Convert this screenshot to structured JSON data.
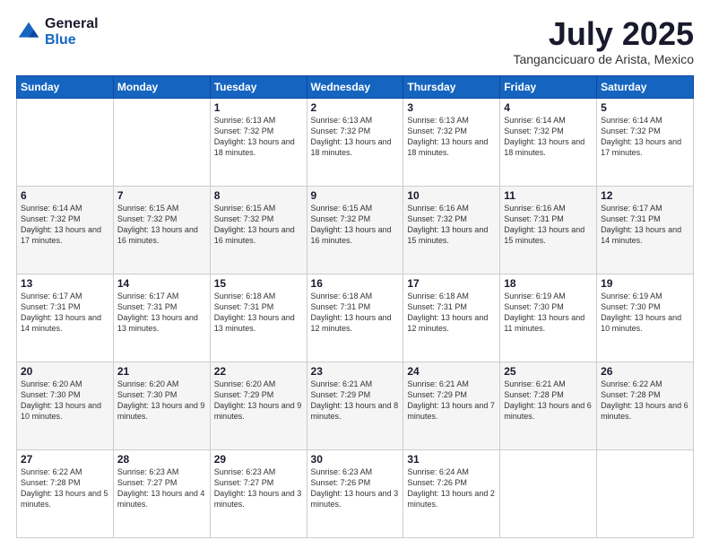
{
  "header": {
    "logo": {
      "line1": "General",
      "line2": "Blue"
    },
    "title": "July 2025",
    "subtitle": "Tangancicuaro de Arista, Mexico"
  },
  "calendar": {
    "headers": [
      "Sunday",
      "Monday",
      "Tuesday",
      "Wednesday",
      "Thursday",
      "Friday",
      "Saturday"
    ],
    "weeks": [
      [
        {
          "day": "",
          "sunrise": "",
          "sunset": "",
          "daylight": ""
        },
        {
          "day": "",
          "sunrise": "",
          "sunset": "",
          "daylight": ""
        },
        {
          "day": "1",
          "sunrise": "Sunrise: 6:13 AM",
          "sunset": "Sunset: 7:32 PM",
          "daylight": "Daylight: 13 hours and 18 minutes."
        },
        {
          "day": "2",
          "sunrise": "Sunrise: 6:13 AM",
          "sunset": "Sunset: 7:32 PM",
          "daylight": "Daylight: 13 hours and 18 minutes."
        },
        {
          "day": "3",
          "sunrise": "Sunrise: 6:13 AM",
          "sunset": "Sunset: 7:32 PM",
          "daylight": "Daylight: 13 hours and 18 minutes."
        },
        {
          "day": "4",
          "sunrise": "Sunrise: 6:14 AM",
          "sunset": "Sunset: 7:32 PM",
          "daylight": "Daylight: 13 hours and 18 minutes."
        },
        {
          "day": "5",
          "sunrise": "Sunrise: 6:14 AM",
          "sunset": "Sunset: 7:32 PM",
          "daylight": "Daylight: 13 hours and 17 minutes."
        }
      ],
      [
        {
          "day": "6",
          "sunrise": "Sunrise: 6:14 AM",
          "sunset": "Sunset: 7:32 PM",
          "daylight": "Daylight: 13 hours and 17 minutes."
        },
        {
          "day": "7",
          "sunrise": "Sunrise: 6:15 AM",
          "sunset": "Sunset: 7:32 PM",
          "daylight": "Daylight: 13 hours and 16 minutes."
        },
        {
          "day": "8",
          "sunrise": "Sunrise: 6:15 AM",
          "sunset": "Sunset: 7:32 PM",
          "daylight": "Daylight: 13 hours and 16 minutes."
        },
        {
          "day": "9",
          "sunrise": "Sunrise: 6:15 AM",
          "sunset": "Sunset: 7:32 PM",
          "daylight": "Daylight: 13 hours and 16 minutes."
        },
        {
          "day": "10",
          "sunrise": "Sunrise: 6:16 AM",
          "sunset": "Sunset: 7:32 PM",
          "daylight": "Daylight: 13 hours and 15 minutes."
        },
        {
          "day": "11",
          "sunrise": "Sunrise: 6:16 AM",
          "sunset": "Sunset: 7:31 PM",
          "daylight": "Daylight: 13 hours and 15 minutes."
        },
        {
          "day": "12",
          "sunrise": "Sunrise: 6:17 AM",
          "sunset": "Sunset: 7:31 PM",
          "daylight": "Daylight: 13 hours and 14 minutes."
        }
      ],
      [
        {
          "day": "13",
          "sunrise": "Sunrise: 6:17 AM",
          "sunset": "Sunset: 7:31 PM",
          "daylight": "Daylight: 13 hours and 14 minutes."
        },
        {
          "day": "14",
          "sunrise": "Sunrise: 6:17 AM",
          "sunset": "Sunset: 7:31 PM",
          "daylight": "Daylight: 13 hours and 13 minutes."
        },
        {
          "day": "15",
          "sunrise": "Sunrise: 6:18 AM",
          "sunset": "Sunset: 7:31 PM",
          "daylight": "Daylight: 13 hours and 13 minutes."
        },
        {
          "day": "16",
          "sunrise": "Sunrise: 6:18 AM",
          "sunset": "Sunset: 7:31 PM",
          "daylight": "Daylight: 13 hours and 12 minutes."
        },
        {
          "day": "17",
          "sunrise": "Sunrise: 6:18 AM",
          "sunset": "Sunset: 7:31 PM",
          "daylight": "Daylight: 13 hours and 12 minutes."
        },
        {
          "day": "18",
          "sunrise": "Sunrise: 6:19 AM",
          "sunset": "Sunset: 7:30 PM",
          "daylight": "Daylight: 13 hours and 11 minutes."
        },
        {
          "day": "19",
          "sunrise": "Sunrise: 6:19 AM",
          "sunset": "Sunset: 7:30 PM",
          "daylight": "Daylight: 13 hours and 10 minutes."
        }
      ],
      [
        {
          "day": "20",
          "sunrise": "Sunrise: 6:20 AM",
          "sunset": "Sunset: 7:30 PM",
          "daylight": "Daylight: 13 hours and 10 minutes."
        },
        {
          "day": "21",
          "sunrise": "Sunrise: 6:20 AM",
          "sunset": "Sunset: 7:30 PM",
          "daylight": "Daylight: 13 hours and 9 minutes."
        },
        {
          "day": "22",
          "sunrise": "Sunrise: 6:20 AM",
          "sunset": "Sunset: 7:29 PM",
          "daylight": "Daylight: 13 hours and 9 minutes."
        },
        {
          "day": "23",
          "sunrise": "Sunrise: 6:21 AM",
          "sunset": "Sunset: 7:29 PM",
          "daylight": "Daylight: 13 hours and 8 minutes."
        },
        {
          "day": "24",
          "sunrise": "Sunrise: 6:21 AM",
          "sunset": "Sunset: 7:29 PM",
          "daylight": "Daylight: 13 hours and 7 minutes."
        },
        {
          "day": "25",
          "sunrise": "Sunrise: 6:21 AM",
          "sunset": "Sunset: 7:28 PM",
          "daylight": "Daylight: 13 hours and 6 minutes."
        },
        {
          "day": "26",
          "sunrise": "Sunrise: 6:22 AM",
          "sunset": "Sunset: 7:28 PM",
          "daylight": "Daylight: 13 hours and 6 minutes."
        }
      ],
      [
        {
          "day": "27",
          "sunrise": "Sunrise: 6:22 AM",
          "sunset": "Sunset: 7:28 PM",
          "daylight": "Daylight: 13 hours and 5 minutes."
        },
        {
          "day": "28",
          "sunrise": "Sunrise: 6:23 AM",
          "sunset": "Sunset: 7:27 PM",
          "daylight": "Daylight: 13 hours and 4 minutes."
        },
        {
          "day": "29",
          "sunrise": "Sunrise: 6:23 AM",
          "sunset": "Sunset: 7:27 PM",
          "daylight": "Daylight: 13 hours and 3 minutes."
        },
        {
          "day": "30",
          "sunrise": "Sunrise: 6:23 AM",
          "sunset": "Sunset: 7:26 PM",
          "daylight": "Daylight: 13 hours and 3 minutes."
        },
        {
          "day": "31",
          "sunrise": "Sunrise: 6:24 AM",
          "sunset": "Sunset: 7:26 PM",
          "daylight": "Daylight: 13 hours and 2 minutes."
        },
        {
          "day": "",
          "sunrise": "",
          "sunset": "",
          "daylight": ""
        },
        {
          "day": "",
          "sunrise": "",
          "sunset": "",
          "daylight": ""
        }
      ]
    ]
  }
}
